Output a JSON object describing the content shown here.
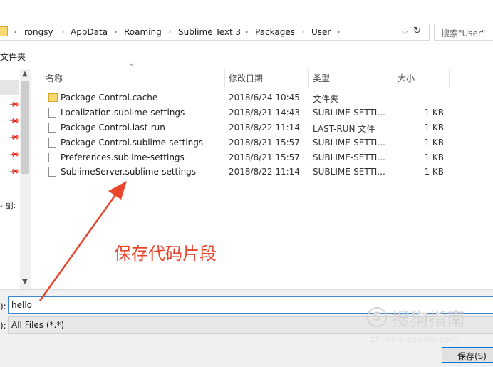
{
  "address_bar": {
    "crumbs": [
      "rongsy",
      "AppData",
      "Roaming",
      "Sublime Text 3",
      "Packages",
      "User"
    ],
    "separator": "›",
    "dropdown_glyph": "⌵",
    "refresh_glyph": "↻",
    "search_placeholder": "搜索\"User\""
  },
  "toolbar": {
    "new_folder_label": "文件夹"
  },
  "nav": {
    "truncated_item": "- 副:",
    "pin_glyph": "📌",
    "up_glyph": "▲",
    "down_glyph": "▼"
  },
  "columns": {
    "name": "名称",
    "date": "修改日期",
    "type": "类型",
    "size": "大小",
    "sort_glyph": "^"
  },
  "files": [
    {
      "name": "Package Control.cache",
      "date": "2018/6/24 10:45",
      "type": "文件夹",
      "size": "",
      "icon": "folder-icon"
    },
    {
      "name": "Localization.sublime-settings",
      "date": "2018/8/21 14:43",
      "type": "SUBLIME-SETTI...",
      "size": "1 KB",
      "icon": "file-icon"
    },
    {
      "name": "Package Control.last-run",
      "date": "2018/8/22 11:14",
      "type": "LAST-RUN 文件",
      "size": "1 KB",
      "icon": "file-icon"
    },
    {
      "name": "Package Control.sublime-settings",
      "date": "2018/8/21 15:57",
      "type": "SUBLIME-SETTI...",
      "size": "1 KB",
      "icon": "file-icon"
    },
    {
      "name": "Preferences.sublime-settings",
      "date": "2018/8/21 15:57",
      "type": "SUBLIME-SETTI...",
      "size": "1 KB",
      "icon": "file-icon"
    },
    {
      "name": "SublimeServer.sublime-settings",
      "date": "2018/8/22 11:14",
      "type": "SUBLIME-SETTI...",
      "size": "1 KB",
      "icon": "file-icon"
    }
  ],
  "annotation": {
    "text": "保存代码片段",
    "color": "#e8452c"
  },
  "filename": {
    "label": "):",
    "value": "hello"
  },
  "filetype": {
    "label": "):",
    "value": "All Files (*.*)"
  },
  "save_button": {
    "label": "保存(S)"
  },
  "watermark": {
    "logo": "S",
    "text": "搜狗指南",
    "url": "zhinan.sogou.com"
  }
}
